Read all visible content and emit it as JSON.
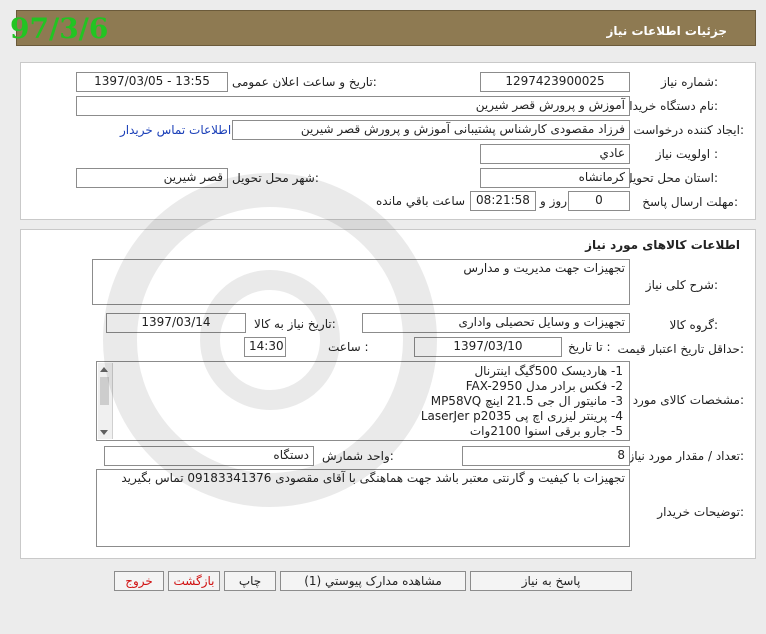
{
  "header": {
    "title": "جزئیات اطلاعات نیاز",
    "date_stamp": "97/3/6"
  },
  "need_info": {
    "need_number_label": "شماره نیاز:",
    "need_number": "1297423900025",
    "announce_label": "تاریخ و ساعت اعلان عمومی:",
    "announce_value": "1397/03/05 - 13:55",
    "buyer_org_label": "نام دستگاه خریدار:",
    "buyer_org": "آموزش و پرورش قصر شیرین",
    "creator_label": "ایجاد کننده درخواست:",
    "creator": "فرزاد مقصودی کارشناس پشتیبانی آموزش و پرورش قصر شیرین",
    "contact_link": "اطلاعات تماس خریدار",
    "priority_label": "اولویت نیاز :",
    "priority": "عادي",
    "province_label": "استان محل تحویل:",
    "province": "کرمانشاه",
    "city_label": "شهر محل تحویل:",
    "city": "قصر شیرین",
    "deadline_label": "مهلت ارسال پاسخ:",
    "days_value": "0",
    "days_label": "روز و",
    "time_value": "08:21:58",
    "remaining_label": "ساعت باقي مانده"
  },
  "goods": {
    "section_title": "اطلاعات کالاهای مورد نیاز",
    "summary_label": "شرح کلی نیاز:",
    "summary": "تجهیزات جهت مدیریت و مدارس",
    "group_label": "گروه کالا:",
    "group": "تجهیزات و وسایل تحصیلی واداری",
    "need_date_label": "تاریخ نیاز به کالا:",
    "need_date": "1397/03/14",
    "validity_label": "حداقل تاریخ اعتبار قیمت:",
    "to_date_label": "تا تاریخ :",
    "to_date": "1397/03/10",
    "time_label": "ساعت :",
    "time": "14:30",
    "specs_label": "مشخصات کالای مورد نیاز:",
    "specs": [
      "1-    هاردیسک  500گیگ  اینترنال",
      "2-    فکس برادر مدل   FAX-2950",
      "3-   مانیتور ال جی  21.5 اینچ   MP58VQ",
      "4-     پرینتر لیزری اچ پی     LaserJer  p2035",
      "5-    جارو برقی اسنوا 2100وات"
    ],
    "qty_label": "تعداد / مقدار مورد نیاز:",
    "qty": "8",
    "unit_label": "واحد شمارش:",
    "unit": "دستگاه",
    "notes_label": "توضیحات خریدار:",
    "notes": "تجهیزات با کیفیت و گارنتی معتبر باشد جهت هماهنگی با آقای مقصودی 09183341376 تماس بگیرید"
  },
  "buttons": {
    "respond": "پاسخ به نیاز",
    "attachments": "مشاهده مدارک پیوستي (1)",
    "print": "چاپ",
    "back": "بازگشت",
    "exit": "خروج"
  },
  "colors": {
    "header_bg": "#8e7a52",
    "date_stamp": "#22c422",
    "link": "#1a3fb8",
    "exit_text": "#d01010"
  }
}
